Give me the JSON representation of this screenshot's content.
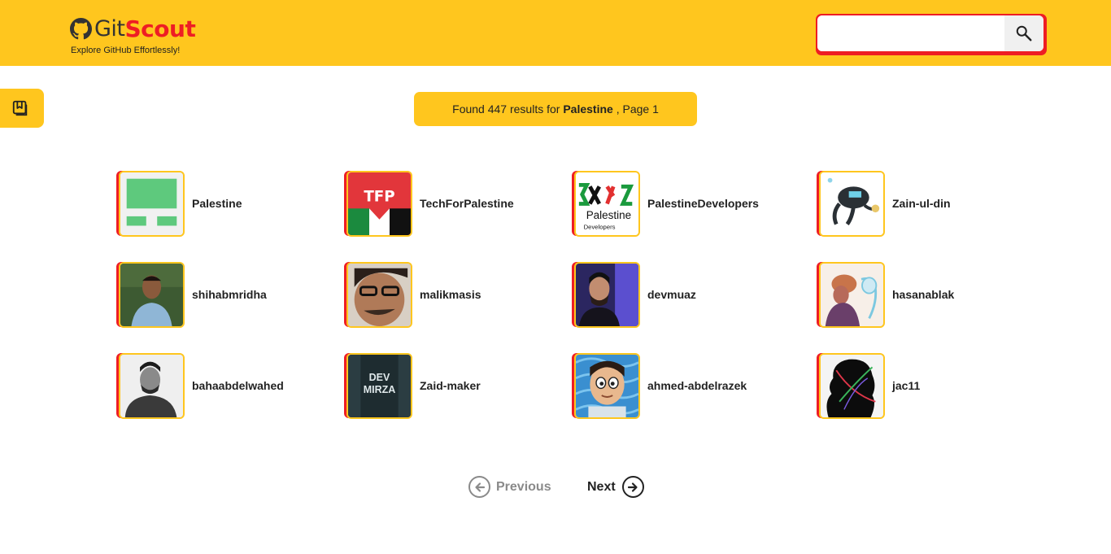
{
  "header": {
    "logo_git": "Git",
    "logo_scout": "Scout",
    "tagline": "Explore GitHub Effortlessly!",
    "search_value": "",
    "search_icon": "search-icon",
    "brand_color": "#ffc61e",
    "accent_color": "#ee1d24"
  },
  "side_tab": {
    "icon": "bookmark-icon"
  },
  "banner": {
    "prefix": "Found 447 results for ",
    "query": "Palestine",
    "suffix": " , Page 1"
  },
  "results": [
    {
      "username": "Palestine"
    },
    {
      "username": "TechForPalestine"
    },
    {
      "username": "PalestineDevelopers"
    },
    {
      "username": "Zain-ul-din"
    },
    {
      "username": "shihabmridha"
    },
    {
      "username": "malikmasis"
    },
    {
      "username": "devmuaz"
    },
    {
      "username": "hasanablak"
    },
    {
      "username": "bahaabdelwahed"
    },
    {
      "username": "Zaid-maker"
    },
    {
      "username": "ahmed-abdelrazek"
    },
    {
      "username": "jac11"
    }
  ],
  "avatar_text": {
    "tfp": "TFP",
    "pd_word": "Palestine",
    "pd_sub": "Developers",
    "dev": "DEV",
    "mirza": "MIRZA"
  },
  "pagination": {
    "previous_label": "Previous",
    "next_label": "Next"
  }
}
